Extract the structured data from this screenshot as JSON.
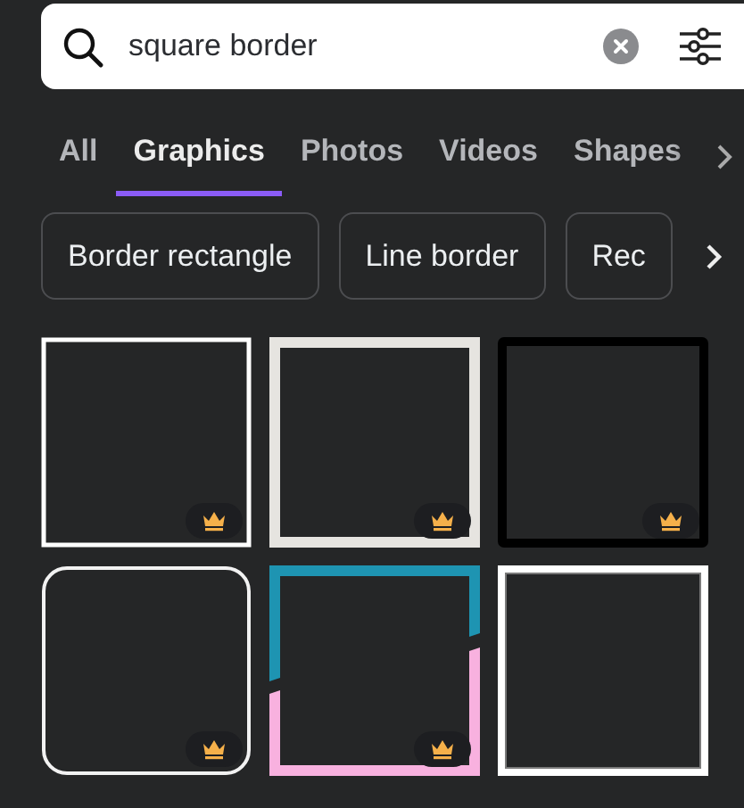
{
  "search": {
    "value": "square border"
  },
  "tabs": [
    {
      "label": "All",
      "selected": false
    },
    {
      "label": "Graphics",
      "selected": true
    },
    {
      "label": "Photos",
      "selected": false
    },
    {
      "label": "Videos",
      "selected": false
    },
    {
      "label": "Shapes",
      "selected": false
    }
  ],
  "suggestions": [
    "Border rectangle",
    "Line border",
    "Rec"
  ],
  "graphics": [
    {
      "kind": "thin-white",
      "premium": true
    },
    {
      "kind": "thick-light",
      "premium": true
    },
    {
      "kind": "thick-black",
      "premium": true
    },
    {
      "kind": "rounded-white",
      "premium": true
    },
    {
      "kind": "split-teal-pink",
      "premium": true
    },
    {
      "kind": "framed-white",
      "premium": false
    }
  ]
}
